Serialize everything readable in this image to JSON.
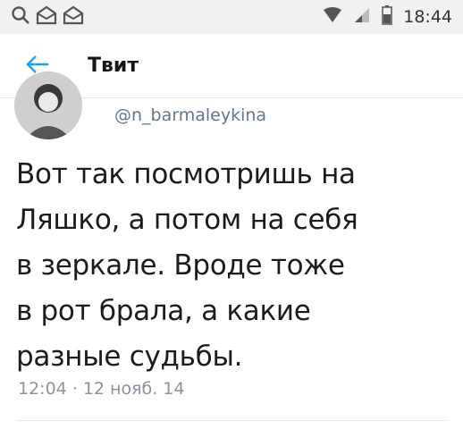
{
  "status_bar": {
    "time": "18:44",
    "icons": [
      "search-icon",
      "mail-icon",
      "mail-icon",
      "wifi-icon",
      "signal-icon",
      "battery-icon"
    ]
  },
  "app_bar": {
    "title": "Твит",
    "back_icon": "arrow-left-icon",
    "accent_color": "#1da1f2"
  },
  "tweet": {
    "handle": "@n_barmaleykina",
    "text_lines": [
      "Вот так посмотришь на",
      "Ляшко, а потом на себя",
      "в зеркале. Вроде тоже",
      "в рот брала, а какие",
      "разные судьбы."
    ],
    "time": "12:04",
    "separator": "·",
    "date": "12 нояб. 14"
  }
}
